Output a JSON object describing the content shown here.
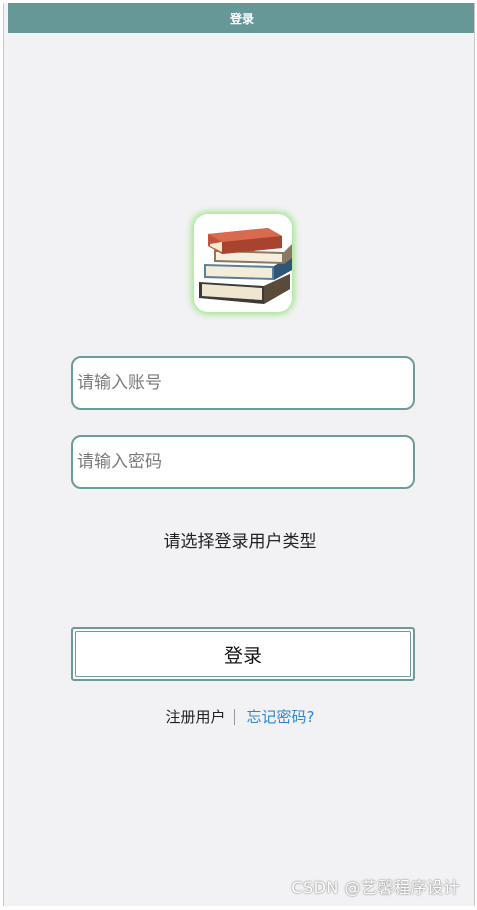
{
  "navbar": {
    "title": "登录"
  },
  "logo": {
    "icon": "books-stack-icon"
  },
  "form": {
    "account_placeholder": "请输入账号",
    "password_placeholder": "请输入密码",
    "user_type_prompt": "请选择登录用户类型",
    "login_label": "登录"
  },
  "links": {
    "register_label": "注册用户",
    "forgot_label": "忘记密码?"
  },
  "watermark": {
    "text": "CSDN @艺馨程序设计"
  },
  "colors": {
    "navbar_bg": "#679898",
    "border": "#6d9a9a",
    "link": "#2f86d0",
    "background": "#f2f1f3"
  }
}
